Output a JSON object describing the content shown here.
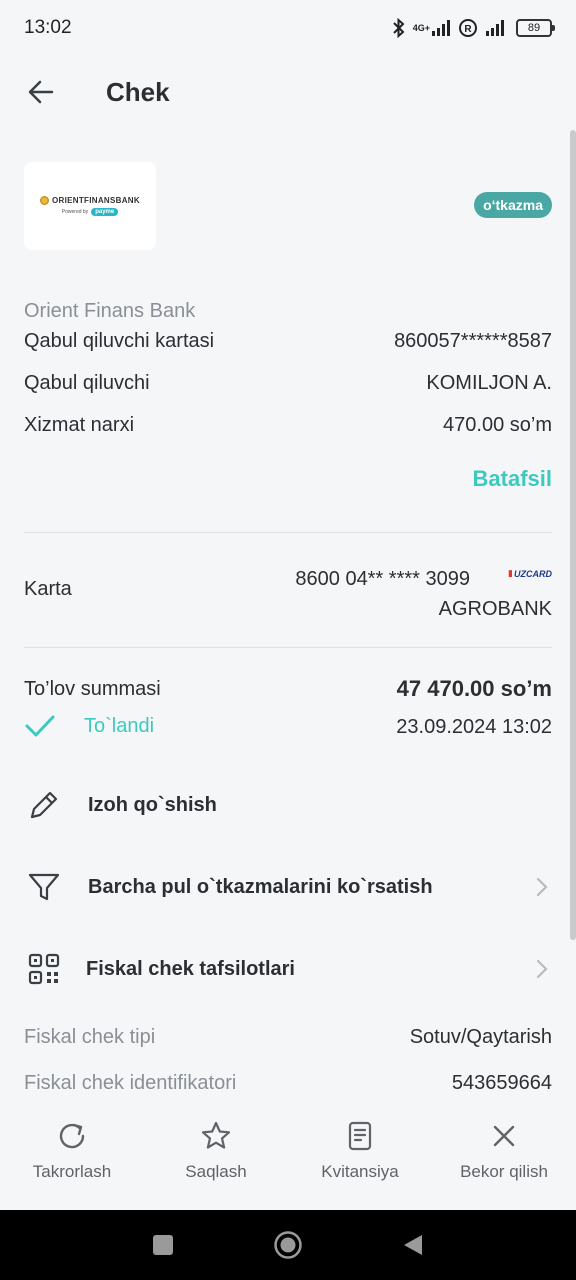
{
  "status_bar": {
    "time": "13:02",
    "network": "4G+",
    "battery": "89",
    "icons": [
      "bluetooth-icon",
      "signal-icon",
      "roaming-icon",
      "signal-icon",
      "battery-icon"
    ]
  },
  "header": {
    "title": "Chek",
    "back_icon": "arrow-left-icon"
  },
  "merchant": {
    "logo_name": "ORIENTFINANSBANK",
    "logo_powered": "Powered by",
    "logo_payme": "payme",
    "type_badge": "o‘tkazma",
    "type_badge_color": "#4aa8a4",
    "bank_name": "Orient Finans Bank"
  },
  "details": [
    {
      "label": "Qabul qiluvchi kartasi",
      "value": "860057******8587"
    },
    {
      "label": "Qabul qiluvchi",
      "value": "KOMILJON A."
    },
    {
      "label": "Xizmat narxi",
      "value": "470.00 so’m"
    }
  ],
  "details_link": "Batafsil",
  "accent_color": "#3ec9c0",
  "card": {
    "label": "Karta",
    "number": "8600 04** **** 3099",
    "brand": "UZCARD",
    "bank": "AGROBANK"
  },
  "payment": {
    "amount_label": "To’lov summasi",
    "amount_value": "47 470.00 so’m",
    "status": "To`landi",
    "datetime": "23.09.2024 13:02"
  },
  "actions": [
    {
      "label": "Izoh qo`shish",
      "icon": "pencil-icon"
    },
    {
      "label": "Barcha pul o`tkazmalarini ko`rsatish",
      "icon": "filter-icon"
    },
    {
      "label": "Fiskal chek tafsilotlari",
      "icon": "qr-code-icon"
    }
  ],
  "fiscal": [
    {
      "label": "Fiskal chek tipi",
      "value": "Sotuv/Qaytarish"
    },
    {
      "label": "Fiskal chek identifikatori",
      "value": "543659664"
    }
  ],
  "bottom_tabs": [
    {
      "label": "Takrorlash",
      "icon": "refresh-icon"
    },
    {
      "label": "Saqlash",
      "icon": "star-icon"
    },
    {
      "label": "Kvitansiya",
      "icon": "receipt-icon"
    },
    {
      "label": "Bekor qilish",
      "icon": "close-icon"
    }
  ],
  "system_nav": [
    "recent-apps-icon",
    "home-icon",
    "back-icon"
  ]
}
